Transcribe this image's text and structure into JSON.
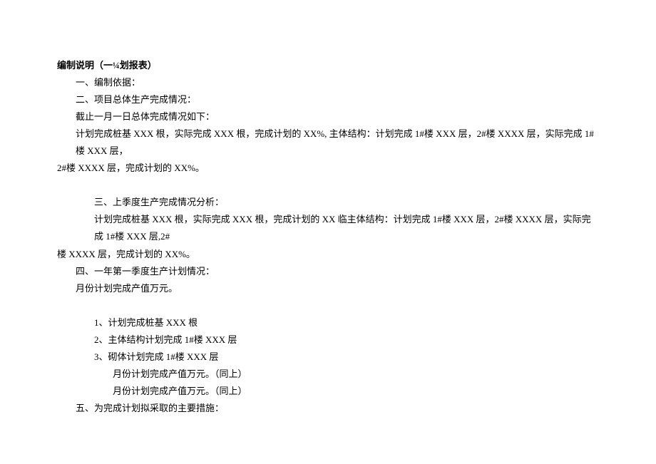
{
  "title": "编制说明（一¼划报表）",
  "lines": {
    "s1": "一、编制依据：",
    "s2": "二、项目总体生产完成情况：",
    "s2_sub1": "截止一月一日总体完成情况如下：",
    "s2_sub2": "计划完成桩基 XXX 根，实际完成 XXX 根，完成计划的 XX%, 主体结构：计划完成 1#楼 XXX 层，2#楼 XXXX 层，实际完成 1#楼 XXX 层，",
    "s2_sub3": "2#楼 XXXX 层，完成计划的 XX%。",
    "s3": "三、上季度生产完成情况分析：",
    "s3_sub1": "计划完成桩基 XXX 根，实际完成 XXX 根，完成计划的 XX 临主体结构：计划完成 1#楼 XXX 层，2#楼 XXXX 层，实际完成 1#楼 XXX 层,2#",
    "s3_sub2": "楼 XXXX 层，完成计划的 XX%。",
    "s4": "四、一年第一季度生产计划情况：",
    "s4_sub1": "月份计划完成产值万元。",
    "s4_item1": "1、计划完成桩基 XXX 根",
    "s4_item2": "2、主体结构计划完成 1#楼 XXX 层",
    "s4_item3": "3、砌体计划完成 1#楼 XXX 层",
    "s4_item3_sub1": "月份计划完成产值万元。（同上）",
    "s4_item3_sub2": "月份计划完成产值万元。（同上）",
    "s5": "五、为完成计划拟采取的主要措施："
  }
}
